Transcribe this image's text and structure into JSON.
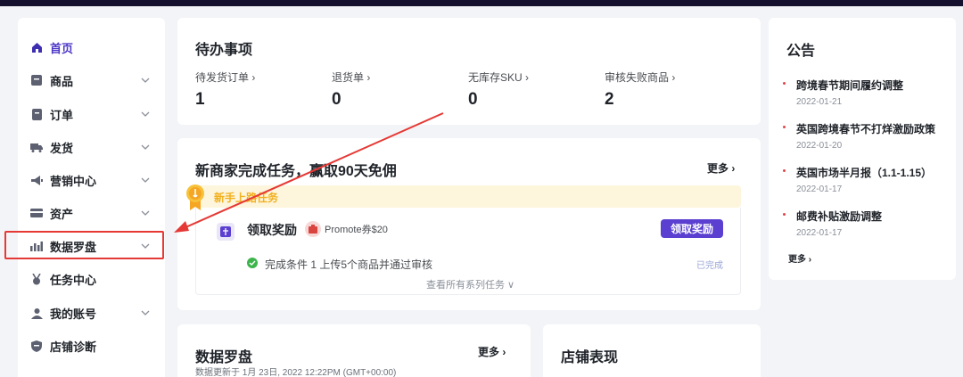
{
  "sidebar": {
    "items": [
      {
        "label": "首页",
        "icon": "home-icon",
        "active": true,
        "expandable": false
      },
      {
        "label": "商品",
        "icon": "product-icon",
        "active": false,
        "expandable": true
      },
      {
        "label": "订单",
        "icon": "order-icon",
        "active": false,
        "expandable": true
      },
      {
        "label": "发货",
        "icon": "truck-icon",
        "active": false,
        "expandable": true
      },
      {
        "label": "营销中心",
        "icon": "megaphone-icon",
        "active": false,
        "expandable": true
      },
      {
        "label": "资产",
        "icon": "card-icon",
        "active": false,
        "expandable": true
      },
      {
        "label": "数据罗盘",
        "icon": "bar-chart-icon",
        "active": false,
        "expandable": true,
        "highlighted": true
      },
      {
        "label": "任务中心",
        "icon": "medal-icon",
        "active": false,
        "expandable": false
      },
      {
        "label": "我的账号",
        "icon": "user-icon",
        "active": false,
        "expandable": true
      },
      {
        "label": "店铺诊断",
        "icon": "shield-icon",
        "active": false,
        "expandable": false
      }
    ]
  },
  "todo": {
    "title": "待办事项",
    "items": [
      {
        "label": "待发货订单 ›",
        "value": "1"
      },
      {
        "label": "退货单 ›",
        "value": "0"
      },
      {
        "label": "无库存SKU ›",
        "value": "0"
      },
      {
        "label": "审核失败商品 ›",
        "value": "2"
      }
    ]
  },
  "task": {
    "title": "新商家完成任务，赢取90天免佣",
    "more": "更多 ›",
    "banner": "新手上路任务",
    "reward_title": "领取奖励",
    "promo": "Promote券$20",
    "claim_button": "领取奖励",
    "condition": "完成条件 1  上传5个商品并通过审核",
    "done": "已完成",
    "view_all": "查看所有系列任务 ∨"
  },
  "compass": {
    "title": "数据罗盘",
    "more": "更多 ›",
    "updated": "数据更新于 1月 23日, 2022 12:22PM (GMT+00:00)"
  },
  "store": {
    "title": "店铺表现"
  },
  "notice": {
    "title": "公告",
    "items": [
      {
        "title": "跨境春节期间履约调整",
        "date": "2022-01-21"
      },
      {
        "title": "英国跨境春节不打烊激励政策",
        "date": "2022-01-20"
      },
      {
        "title": "英国市场半月报（1.1-1.15）",
        "date": "2022-01-17"
      },
      {
        "title": "邮费补贴激励调整",
        "date": "2022-01-17"
      }
    ],
    "more": "更多 ›"
  },
  "colors": {
    "accent": "#4b36c6",
    "button": "#5b3fd1",
    "annotation": "#e53935",
    "topbar": "#14102e"
  }
}
